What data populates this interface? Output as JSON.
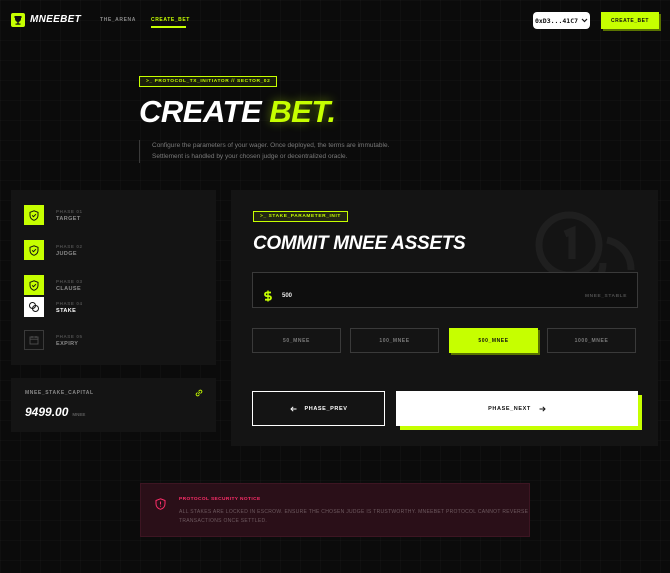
{
  "nav": {
    "brand": "MNEEBET",
    "links": [
      "THE_ARENA",
      "CREATE_BET"
    ],
    "wallet": "0xD3...41C7",
    "cta": "CREATE_BET"
  },
  "hero": {
    "tag": ">_ PROTOCOL_TX_INITIATOR // SECTOR_02",
    "title_main": "CREATE",
    "title_accent": "BET.",
    "desc_line1": "Configure the parameters of your wager. Once deployed, the terms are immutable.",
    "desc_line2": "Settlement is handled by your chosen judge or decentralized oracle."
  },
  "phases": [
    {
      "sub": "PHASE 01",
      "label": "TARGET",
      "status": "done"
    },
    {
      "sub": "PHASE 02",
      "label": "JUDGE",
      "status": "done"
    },
    {
      "sub": "PHASE 03",
      "label": "CLAUSE",
      "status": "done"
    },
    {
      "sub": "PHASE 04",
      "label": "STAKE",
      "status": "active"
    },
    {
      "sub": "PHASE 05",
      "label": "EXPIRY",
      "status": "todo"
    }
  ],
  "capital": {
    "label": "MNEE_STAKE_CAPITAL",
    "value": "9499.00",
    "unit": "MNEE"
  },
  "stake": {
    "tag": ">_ STAKE_PARAMETER_INIT",
    "title": "COMMIT MNEE ASSETS",
    "input_value": "500",
    "input_suffix": "MNEE_STABLE",
    "options": [
      "50_MNEE",
      "100_MNEE",
      "500_MNEE",
      "1000_MNEE"
    ],
    "selected_option": "500_MNEE",
    "prev_label": "PHASE_PREV",
    "next_label": "PHASE_NEXT"
  },
  "notice": {
    "title": "PROTOCOL SECURITY NOTICE",
    "line1": "ALL STAKES ARE LOCKED IN ESCROW. ENSURE THE CHOSEN JUDGE IS TRUSTWORTHY. MNEEBET PROTOCOL CANNOT REVERSE",
    "line2": "TRANSACTIONS ONCE SETTLED."
  },
  "colors": {
    "accent": "#c6ff00",
    "background": "#0b0b0b",
    "panel": "#141414",
    "notice_bg": "#2a0f18",
    "notice_accent": "#ff2e6a"
  }
}
